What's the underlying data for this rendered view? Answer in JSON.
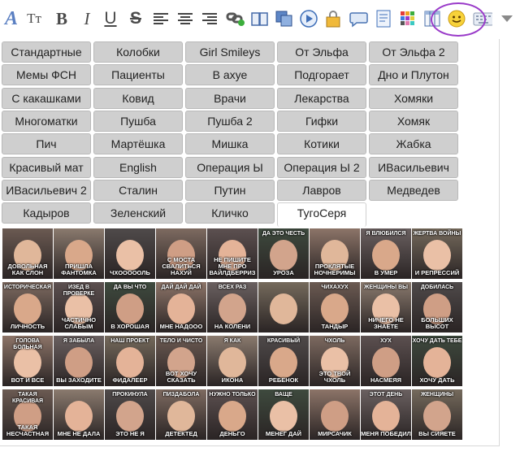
{
  "toolbar": {
    "font_label": "A",
    "size_label": "Tт",
    "bold_label": "B",
    "italic_label": "I",
    "underline_label": "U",
    "strike_label": "S"
  },
  "tabs": [
    [
      "Стандартные",
      "Колобки",
      "Girl Smileys",
      "От Эльфа",
      "От Эльфа 2"
    ],
    [
      "Мемы ФСН",
      "Пациенты",
      "В ахуе",
      "Подгорает",
      "Дно и Плутон"
    ],
    [
      "С какашками",
      "Ковид",
      "Врачи",
      "Лекарства",
      "Хомяки"
    ],
    [
      "Многоматки",
      "Пушба",
      "Пушба 2",
      "Гифки",
      "Хомяк"
    ],
    [
      "Пич",
      "Мартёшка",
      "Мишка",
      "Котики",
      "Жабка"
    ],
    [
      "Красивый мат",
      "English",
      "Операция Ы",
      "Операция Ы 2",
      "ИВасильевич"
    ],
    [
      "ИВасильевич 2",
      "Сталин",
      "Путин",
      "Лавров",
      "Медведев"
    ],
    [
      "Кадыров",
      "Зеленский",
      "Кличко",
      "ТугоСеря"
    ]
  ],
  "active_tab": "ТугоСеря",
  "stickers": [
    [
      {
        "top": "",
        "cap": "довольная как слон"
      },
      {
        "top": "",
        "cap": "пришла фантомка"
      },
      {
        "top": "",
        "cap": "чхоооооль"
      },
      {
        "top": "",
        "cap": "с моста свалиться нахуй"
      },
      {
        "top": "",
        "cap": "не пишите мне про вайлдберриз"
      },
      {
        "top": "да это честь",
        "cap": "уроза"
      },
      {
        "top": "",
        "cap": "проклятые ночнеримы"
      },
      {
        "top": "я влюбился",
        "cap": "в умер"
      },
      {
        "top": "жертва войны",
        "cap": "и репрессий"
      }
    ],
    [
      {
        "top": "историческая",
        "cap": "личность"
      },
      {
        "top": "изед в проверке",
        "cap": "частично слабым"
      },
      {
        "top": "да вы что",
        "cap": "в хорошая"
      },
      {
        "top": "дай дай дай",
        "cap": "мне надооо"
      },
      {
        "top": "всех раз",
        "cap": "на колени"
      },
      {
        "top": "",
        "cap": ""
      },
      {
        "top": "чихахух",
        "cap": "тандыр"
      },
      {
        "top": "женщины вы",
        "cap": "ничего не знаете"
      },
      {
        "top": "добилась",
        "cap": "больших высот"
      }
    ],
    [
      {
        "top": "голова больная",
        "cap": "вот и все"
      },
      {
        "top": "я забыла",
        "cap": "вы заходите"
      },
      {
        "top": "наш проект",
        "cap": "фидалеер"
      },
      {
        "top": "тело и чисто",
        "cap": "вот хочу сказать"
      },
      {
        "top": "я как",
        "cap": "икона"
      },
      {
        "top": "красивый",
        "cap": "ребенок"
      },
      {
        "top": "чхоль",
        "cap": "это твой чхоль"
      },
      {
        "top": "хух",
        "cap": "насмеяя"
      },
      {
        "top": "хочу дать тебе",
        "cap": "хочу дать"
      }
    ],
    [
      {
        "top": "такая красивая",
        "cap": "такая несчастная"
      },
      {
        "top": "",
        "cap": "мне не дала"
      },
      {
        "top": "прокинула",
        "cap": "это не я"
      },
      {
        "top": "пиздабола",
        "cap": "детектед"
      },
      {
        "top": "нужно только",
        "cap": "деньго"
      },
      {
        "top": "ваще",
        "cap": "менег дай"
      },
      {
        "top": "",
        "cap": "мирсачик"
      },
      {
        "top": "этот день",
        "cap": "меня победил"
      },
      {
        "top": "женщины",
        "cap": "вы сияете"
      }
    ]
  ],
  "colors": {
    "accent": "#9a3bc9",
    "tab_bg": "#cfcfcf",
    "tab_border": "#b9b9b9",
    "toolbar_icon": "#4a4a4a"
  }
}
